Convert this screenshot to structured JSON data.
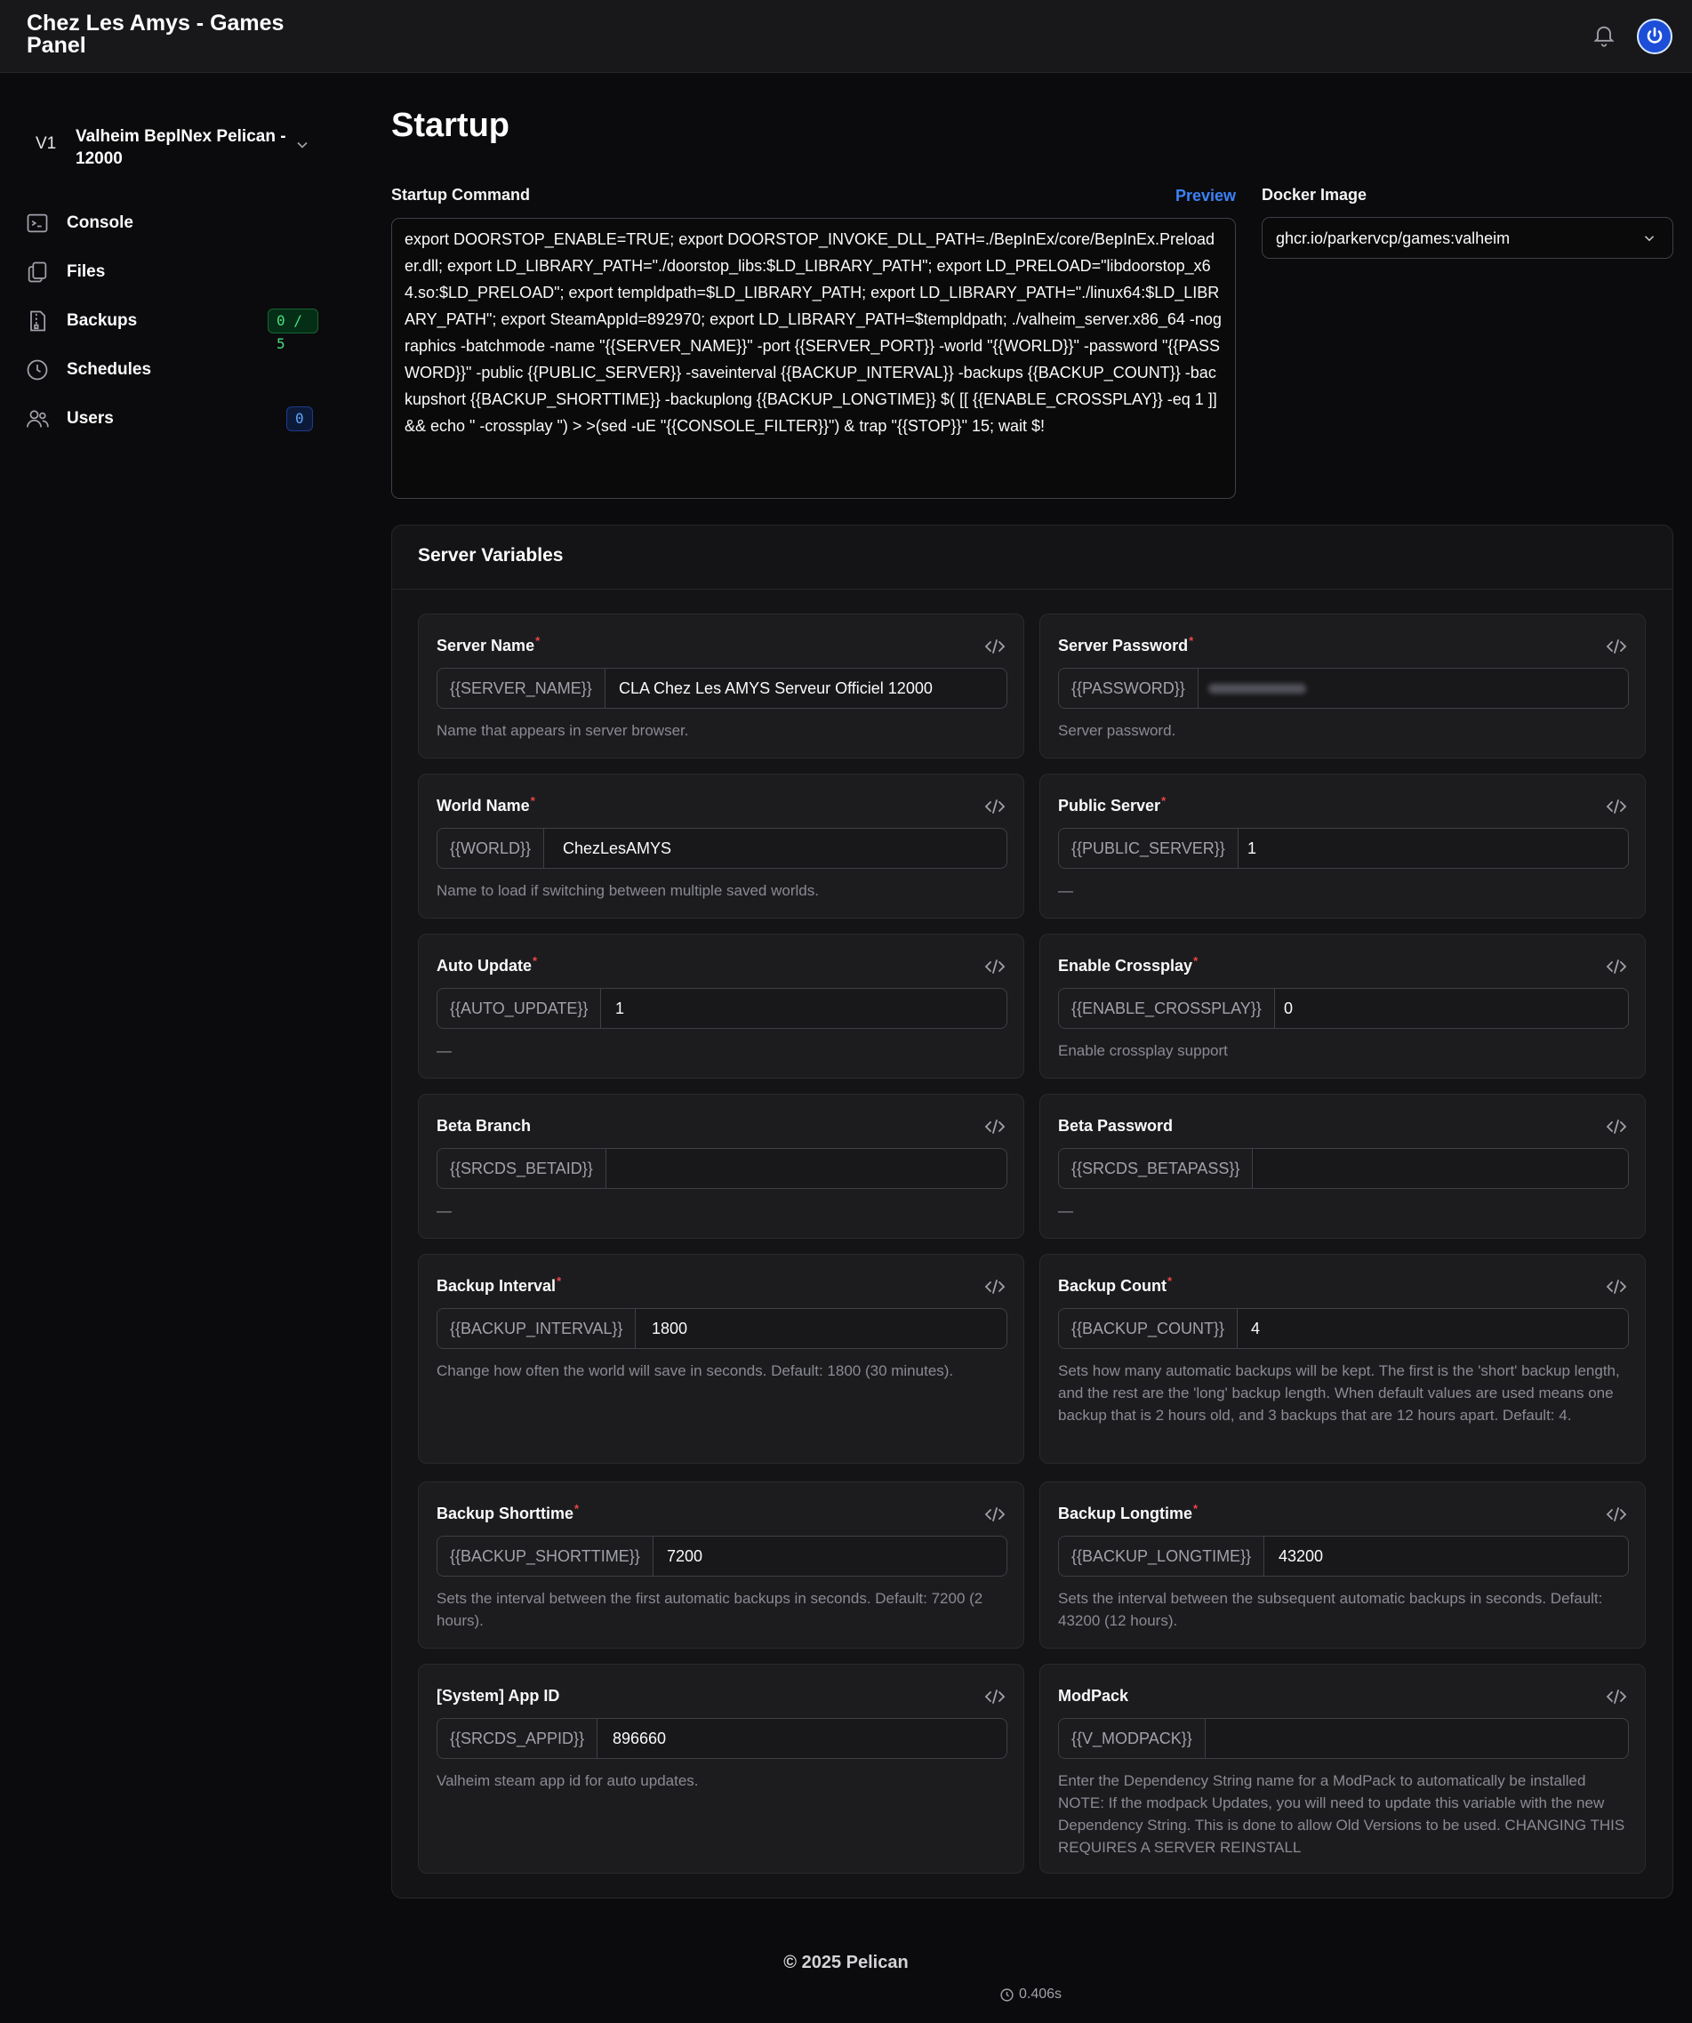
{
  "header": {
    "brand": "Chez Les Amys - Games Panel"
  },
  "sidebar": {
    "server_prefix": "V1",
    "server_name": "Valheim BeplNex Pelican - 12000",
    "items": [
      {
        "label": "Console",
        "icon": "terminal-icon"
      },
      {
        "label": "Files",
        "icon": "files-icon"
      },
      {
        "label": "Backups",
        "icon": "archive-icon",
        "badge": "0 / 5"
      },
      {
        "label": "Schedules",
        "icon": "clock-icon"
      },
      {
        "label": "Users",
        "icon": "users-icon",
        "badge": "0"
      }
    ]
  },
  "page": {
    "title": "Startup",
    "startup_label": "Startup Command",
    "preview_label": "Preview",
    "startup_command": "export DOORSTOP_ENABLE=TRUE; export DOORSTOP_INVOKE_DLL_PATH=./BepInEx/core/BepInEx.Preloader.dll; export LD_LIBRARY_PATH=\"./doorstop_libs:$LD_LIBRARY_PATH\"; export LD_PRELOAD=\"libdoorstop_x64.so:$LD_PRELOAD\"; export templdpath=$LD_LIBRARY_PATH; export LD_LIBRARY_PATH=\"./linux64:$LD_LIBRARY_PATH\"; export SteamAppId=892970; export LD_LIBRARY_PATH=$templdpath; ./valheim_server.x86_64 -nographics -batchmode -name \"{{SERVER_NAME}}\" -port {{SERVER_PORT}} -world \"{{WORLD}}\" -password \"{{PASSWORD}}\" -public {{PUBLIC_SERVER}} -saveinterval {{BACKUP_INTERVAL}} -backups {{BACKUP_COUNT}} -backupshort {{BACKUP_SHORTTIME}} -backuplong {{BACKUP_LONGTIME}} $( [[ {{ENABLE_CROSSPLAY}} -eq 1 ]] && echo \" -crossplay \") > >(sed -uE \"{{CONSOLE_FILTER}}\") & trap \"{{STOP}}\" 15; wait $!",
    "docker_label": "Docker Image",
    "docker_image": "ghcr.io/parkervcp/games:valheim"
  },
  "variables": {
    "title": "Server Variables",
    "items": [
      {
        "label": "Server Name",
        "required": "*",
        "prefix": "{{SERVER_NAME}}",
        "value": "CLA Chez Les AMYS Serveur Officiel 12000",
        "description": "Name that appears in server browser."
      },
      {
        "label": "Server Password",
        "required": "*",
        "prefix": "{{PASSWORD}}",
        "value": "",
        "description": "Server password."
      },
      {
        "label": "World Name",
        "required": "*",
        "prefix": "{{WORLD}}",
        "value": "ChezLesAMYS",
        "description": "Name to load if switching between multiple saved worlds."
      },
      {
        "label": "Public Server",
        "required": "*",
        "prefix": "{{PUBLIC_SERVER}}",
        "value": "1",
        "description": "—"
      },
      {
        "label": "Auto Update",
        "required": "*",
        "prefix": "{{AUTO_UPDATE}}",
        "value": "1",
        "description": "—"
      },
      {
        "label": "Enable Crossplay",
        "required": "*",
        "prefix": "{{ENABLE_CROSSPLAY}}",
        "value": "0",
        "description": "Enable crossplay support"
      },
      {
        "label": "Beta Branch",
        "required": "",
        "prefix": "{{SRCDS_BETAID}}",
        "value": "",
        "description": "—"
      },
      {
        "label": "Beta Password",
        "required": "",
        "prefix": "{{SRCDS_BETAPASS}}",
        "value": "",
        "description": "—"
      },
      {
        "label": "Backup Interval",
        "required": "*",
        "prefix": "{{BACKUP_INTERVAL}}",
        "value": "1800",
        "description": "Change how often the world will save in seconds. Default: 1800 (30 minutes)."
      },
      {
        "label": "Backup Count",
        "required": "*",
        "prefix": "{{BACKUP_COUNT}}",
        "value": "4",
        "description": "Sets how many automatic backups will be kept. The first is the 'short' backup length, and the rest are the 'long' backup length. When default values are used means one backup that is 2 hours old, and 3 backups that are 12 hours apart. Default: 4."
      },
      {
        "label": "Backup Shorttime",
        "required": "*",
        "prefix": "{{BACKUP_SHORTTIME}}",
        "value": "7200",
        "description": "Sets the interval between the first automatic backups in seconds. Default: 7200 (2 hours)."
      },
      {
        "label": "Backup Longtime",
        "required": "*",
        "prefix": "{{BACKUP_LONGTIME}}",
        "value": "43200",
        "description": "Sets the interval between the subsequent automatic backups in seconds. Default: 43200 (12 hours)."
      },
      {
        "label": "[System] App ID",
        "required": "",
        "prefix": "{{SRCDS_APPID}}",
        "value": "896660",
        "description": "Valheim steam app id for auto updates."
      },
      {
        "label": "ModPack",
        "required": "",
        "prefix": "{{V_MODPACK}}",
        "value": "",
        "description": "Enter the Dependency String name for a ModPack to automatically be installed NOTE: If the modpack Updates, you will need to update this variable with the new Dependency String. This is done to allow Old Versions to be used. CHANGING THIS REQUIRES A SERVER REINSTALL"
      }
    ]
  },
  "footer": {
    "copyright": "© 2025 Pelican",
    "time": "0.406s"
  },
  "colors": {
    "accent": "#3b82f6",
    "required": "#ef4444",
    "badge_green": "#4ade80"
  }
}
